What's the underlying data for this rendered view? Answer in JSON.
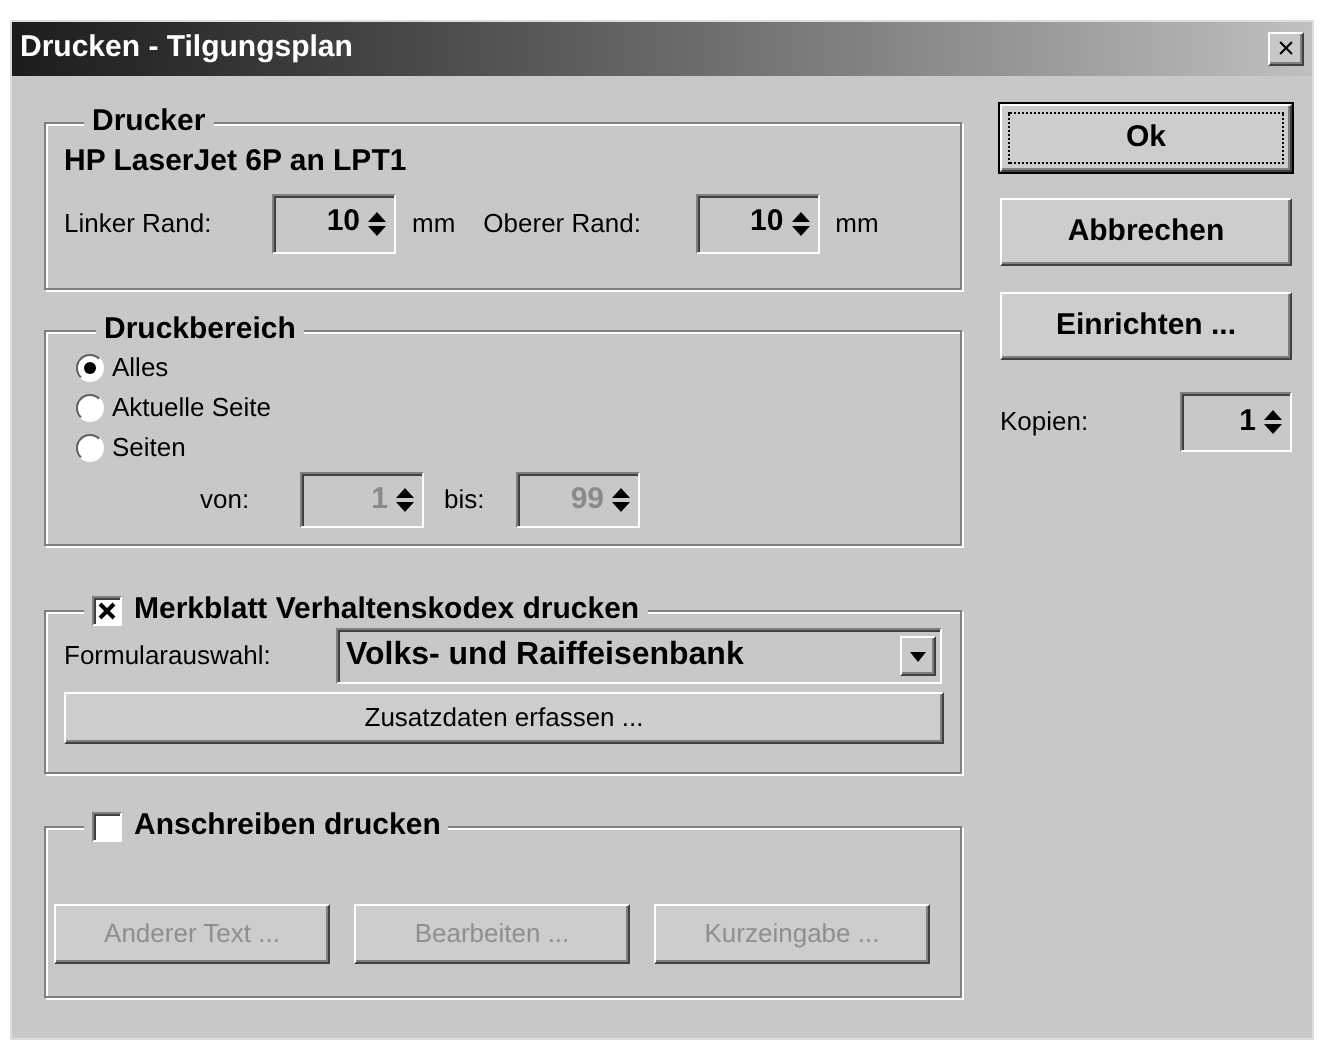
{
  "window": {
    "title": "Drucken - Tilgungsplan",
    "close": "×"
  },
  "printer": {
    "title": "Drucker",
    "name": "HP LaserJet 6P an LPT1",
    "fields": [
      {
        "label": "Linker Rand:",
        "value": "10",
        "unit": "mm"
      },
      {
        "label": "Oberer Rand:",
        "value": "10",
        "unit": "mm"
      }
    ]
  },
  "range": {
    "title": "Druckbereich",
    "options": [
      {
        "label": "Alles",
        "selected": true
      },
      {
        "label": "Aktuelle Seite",
        "selected": false
      },
      {
        "label": "Seiten",
        "selected": false
      }
    ],
    "fields": [
      {
        "label": "von:",
        "value": "1",
        "disabled": true
      },
      {
        "label": "bis:",
        "value": "99",
        "disabled": true
      }
    ]
  },
  "leaflet": {
    "title": "Merkblatt Verhaltenskodex drucken",
    "checked": true,
    "select_label": "Formularauswahl:",
    "select_value": "Volks- und Raiffeisenbank",
    "button": "Zusatzdaten erfassen ..."
  },
  "letter": {
    "title": "Anschreiben drucken",
    "checked": false,
    "buttons": [
      {
        "label": "Anderer Text ...",
        "disabled": true
      },
      {
        "label": "Bearbeiten ...",
        "disabled": true
      },
      {
        "label": "Kurzeingabe ...",
        "disabled": true
      }
    ]
  },
  "buttons": [
    {
      "label": "Ok",
      "default": true
    },
    {
      "label": "Abbrechen",
      "default": false
    },
    {
      "label": "Einrichten ...",
      "default": false
    }
  ],
  "copies": {
    "label": "Kopien:",
    "value": "1"
  }
}
